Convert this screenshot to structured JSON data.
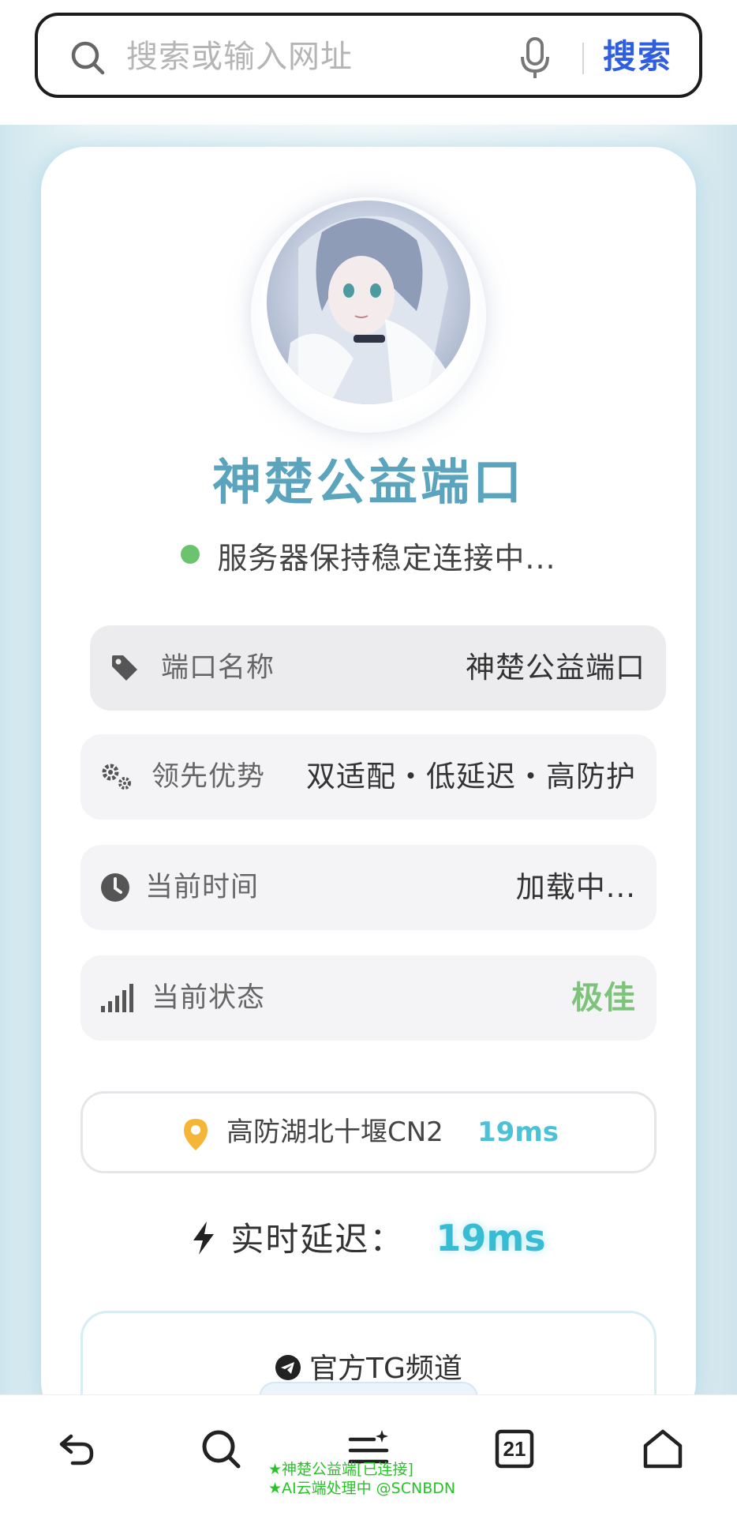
{
  "browser": {
    "search_placeholder": "搜索或输入网址",
    "search_button": "搜索"
  },
  "portal": {
    "title": "神楚公益端口",
    "status_text": "服务器保持稳定连接中...",
    "status_color": "#6cc36e"
  },
  "info_rows": [
    {
      "icon": "tag-icon",
      "label": "端口名称",
      "value": "神楚公益端口"
    },
    {
      "icon": "gears-icon",
      "label": "领先优势",
      "value": "双适配・低延迟・高防护"
    },
    {
      "icon": "clock-icon",
      "label": "当前时间",
      "value": "加载中..."
    },
    {
      "icon": "signal-icon",
      "label": "当前状态",
      "value": "极佳"
    }
  ],
  "node": {
    "icon": "location-pin-icon",
    "name": "高防湖北十堰CN2",
    "latency": "19ms"
  },
  "realtime": {
    "icon": "lightning-bolt-icon",
    "label": "实时延迟：",
    "value": "19ms"
  },
  "telegram": {
    "icon": "telegram-icon",
    "label": "官方TG频道"
  },
  "bottom_nav": {
    "tabs_count": "21",
    "items": [
      "back-icon",
      "search-icon",
      "menu-icon",
      "tabs-icon",
      "home-icon"
    ]
  },
  "overlay": {
    "line1": "★神楚公益端[已连接]",
    "line2": "★AI云端处理中 @SCNBDN"
  },
  "colors": {
    "accent_blue": "#2f5fe0",
    "latency_cyan": "#37bcd4",
    "good_green": "#7dc37a"
  }
}
